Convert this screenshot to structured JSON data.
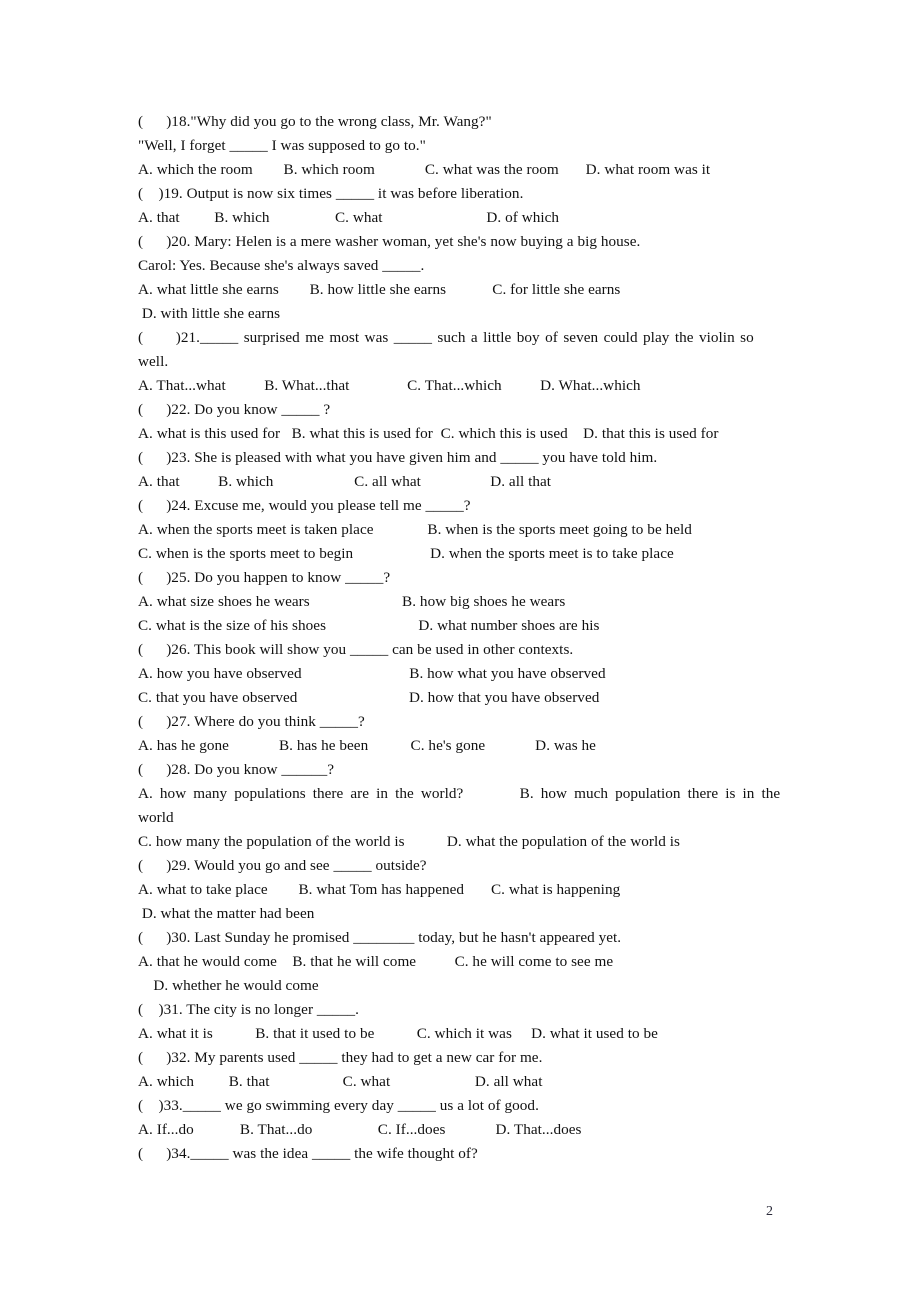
{
  "page": {
    "number": "2",
    "lines": [
      "(      )18.\"Why did you go to the wrong class, Mr. Wang?\"",
      "\"Well, I forget _____ I was supposed to go to.\"",
      "A. which the room        B. which room             C. what was the room       D. what room was it",
      "(    )19. Output is now six times _____ it was before liberation.",
      "A. that         B. which                 C. what                           D. of which",
      "(      )20. Mary: Helen is a mere washer woman, yet she's now buying a big house.",
      "Carol: Yes. Because she's always saved _____.",
      "A. what little she earns        B. how little she earns            C. for little she earns",
      " D. with little she earns",
      "(      )21._____ surprised me most was _____ such a little boy of seven could play the violin so",
      "well.",
      "A. That...what          B. What...that               C. That...which          D. What...which",
      "(      )22. Do you know _____ ?",
      "A. what is this used for   B. what this is used for  C. which this is used    D. that this is used for",
      "(      )23. She is pleased with what you have given him and _____ you have told him.",
      "A. that          B. which                     C. all what                  D. all that",
      "(      )24. Excuse me, would you please tell me _____?",
      "A. when the sports meet is taken place              B. when is the sports meet going to be held",
      "C. when is the sports meet to begin                    D. when the sports meet is to take place",
      "(      )25. Do you happen to know _____?",
      "A. what size shoes he wears                        B. how big shoes he wears",
      "C. what is the size of his shoes                        D. what number shoes are his",
      "(      )26. This book will show you _____ can be used in other contexts.",
      "A. how you have observed                            B. how what you have observed",
      "C. that you have observed                             D. how that you have observed",
      "(      )27. Where do you think _____?",
      "A. has he gone             B. has he been           C. he's gone             D. was he",
      "(      )28. Do you know ______?",
      "A. how many populations there are in the world?        B. how much population there is in the",
      "world",
      "C. how many the population of the world is           D. what the population of the world is",
      "(      )29. Would you go and see _____ outside?",
      "A. what to take place        B. what Tom has happened       C. what is happening",
      " D. what the matter had been",
      "(      )30. Last Sunday he promised ________ today, but he hasn't appeared yet.",
      "A. that he would come    B. that he will come          C. he will come to see me",
      "    D. whether he would come",
      "(    )31. The city is no longer _____.",
      "A. what it is           B. that it used to be           C. which it was     D. what it used to be",
      "(      )32. My parents used _____ they had to get a new car for me.",
      "A. which         B. that                   C. what                      D. all what",
      "(    )33._____ we go swimming every day _____ us a lot of good.",
      "A. If...do            B. That...do                 C. If...does             D. That...does",
      "(      )34._____ was the idea _____ the wife thought of?"
    ]
  }
}
